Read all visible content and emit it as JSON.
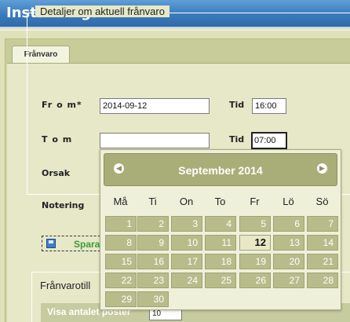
{
  "window": {
    "title": "Inställningar"
  },
  "tabs": [
    {
      "label": "Frånvaro"
    }
  ],
  "details": {
    "legend": "Detaljer om aktuell frånvaro",
    "from_label": "Fr o m*",
    "from_value": "2014-09-12",
    "tid_label": "Tid",
    "from_time": "16:00",
    "to_label": "T o m",
    "to_value": "",
    "tid2_label": "Tid",
    "to_time": "07:00",
    "reason_label": "Orsak",
    "note_label": "Notering",
    "save_label": "Spara"
  },
  "section2": {
    "legend": "Frånvarotill",
    "show_label": "Visa antalet poster",
    "page_size": "10"
  },
  "calendar": {
    "month_title": "September 2014",
    "prev_icon": "chevron-left-icon",
    "next_icon": "chevron-right-icon",
    "weekdays": [
      "Må",
      "Ti",
      "On",
      "To",
      "Fr",
      "Lö",
      "Sö"
    ],
    "days": [
      "1",
      "2",
      "3",
      "4",
      "5",
      "6",
      "7",
      "8",
      "9",
      "10",
      "11",
      "12",
      "13",
      "14",
      "15",
      "16",
      "17",
      "18",
      "19",
      "20",
      "21",
      "22",
      "23",
      "24",
      "25",
      "26",
      "27",
      "28",
      "29",
      "30"
    ],
    "highlighted_day": "12"
  }
}
